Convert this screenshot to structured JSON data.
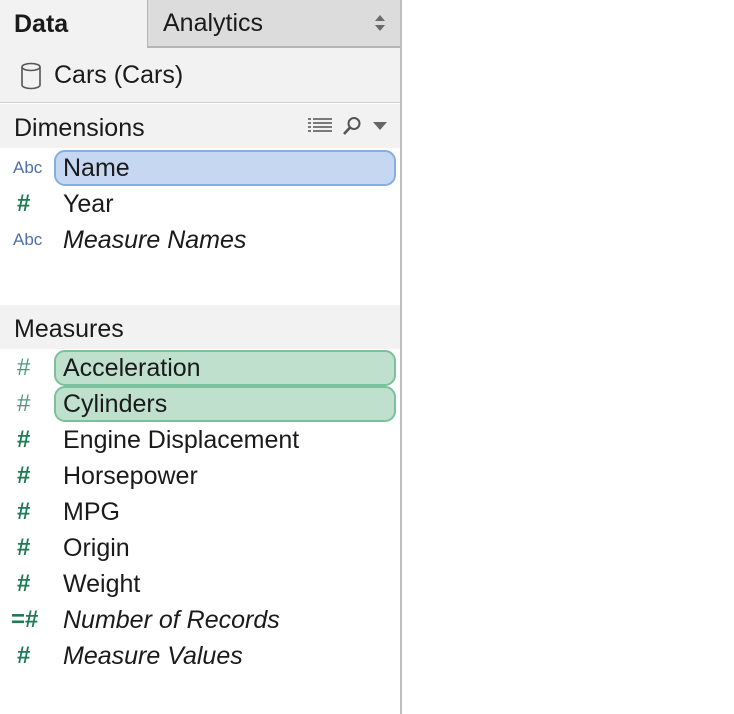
{
  "tabs": [
    {
      "label": "Data"
    },
    {
      "label": "Analytics"
    }
  ],
  "data_source": {
    "label": "Cars (Cars)",
    "icon": "database-icon"
  },
  "dimensions": {
    "title": "Dimensions",
    "items": [
      {
        "label": "Name",
        "type_icon": "Abc",
        "selected": true
      },
      {
        "label": "Year",
        "type_icon": "#"
      },
      {
        "label": "Measure Names",
        "type_icon": "Abc",
        "italic": true
      }
    ]
  },
  "measures": {
    "title": "Measures",
    "items": [
      {
        "label": "Acceleration",
        "type_icon": "#",
        "selected": true
      },
      {
        "label": "Cylinders",
        "type_icon": "#",
        "selected": true
      },
      {
        "label": "Engine Displacement",
        "type_icon": "#"
      },
      {
        "label": "Horsepower",
        "type_icon": "#"
      },
      {
        "label": "MPG",
        "type_icon": "#"
      },
      {
        "label": "Origin",
        "type_icon": "#"
      },
      {
        "label": "Weight",
        "type_icon": "#"
      },
      {
        "label": "Number of Records",
        "type_icon": "=#",
        "italic": true
      },
      {
        "label": "Measure Values",
        "type_icon": "#",
        "italic": true
      }
    ]
  },
  "colors": {
    "dimension_selected": "#c6d7f2",
    "measure_selected": "#bfe0cd",
    "dimension_icon": "#4f6fa8",
    "measure_icon": "#1f7a55"
  }
}
